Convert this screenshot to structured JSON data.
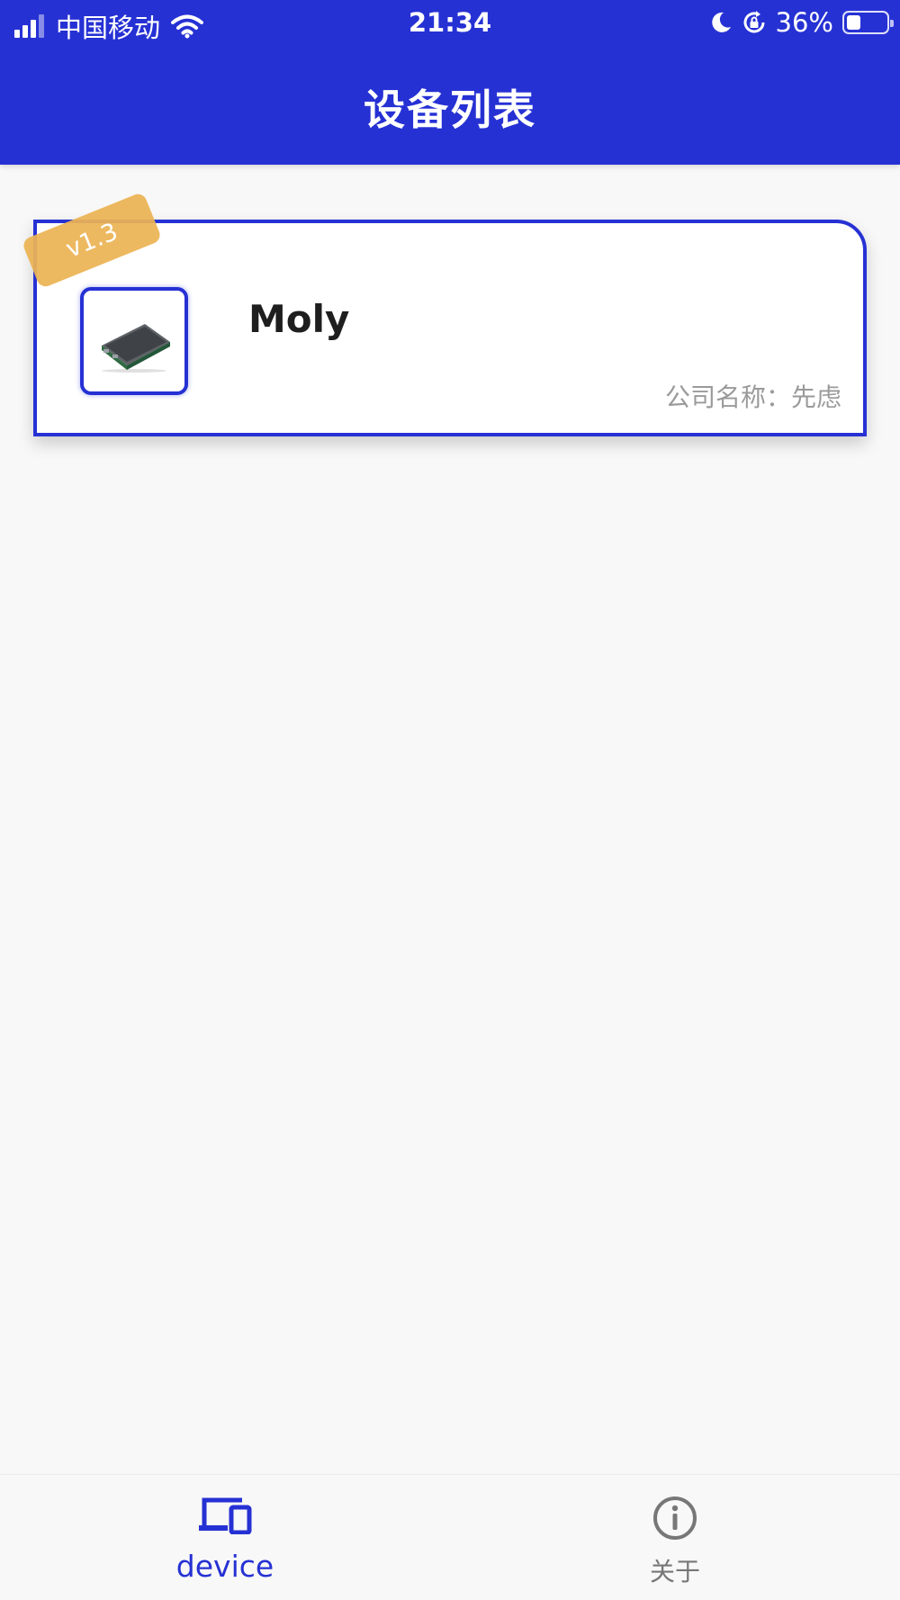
{
  "status_bar": {
    "carrier": "中国移动",
    "time": "21:34",
    "battery_percent": "36%",
    "battery_level": 0.36,
    "icons": [
      "signal-icon",
      "wifi-icon",
      "moon-icon",
      "rotation-lock-icon",
      "battery-icon"
    ]
  },
  "header": {
    "title": "设备列表"
  },
  "colors": {
    "primary": "#2631d4",
    "ribbon": "#ecb454",
    "muted_text": "#9a9a9a",
    "background": "#f8f8f8"
  },
  "devices": [
    {
      "version": "v1.3",
      "name": "Moly",
      "company": "公司名称：先虑",
      "thumbnail": "device-board-image"
    }
  ],
  "tabbar": {
    "tabs": [
      {
        "label": "device",
        "icon": "devices-icon",
        "active": true
      },
      {
        "label": "关于",
        "icon": "info-circle-icon",
        "active": false
      }
    ]
  }
}
